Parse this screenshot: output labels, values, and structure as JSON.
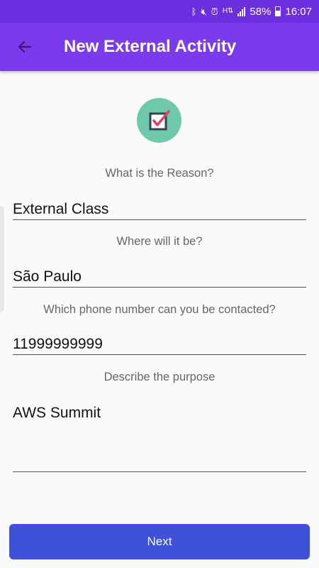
{
  "status_bar": {
    "battery": "58%",
    "time": "16:07",
    "icons": [
      "bluetooth-icon",
      "mute-icon",
      "alarm-icon",
      "data-icon",
      "signal-icon",
      "battery-icon"
    ]
  },
  "app_bar": {
    "title": "New External Activity",
    "color": "#7c3aed"
  },
  "form": {
    "reason": {
      "label": "What is the Reason?",
      "value": "External Class"
    },
    "location": {
      "label": "Where will it be?",
      "value": "São Paulo"
    },
    "phone": {
      "label": "Which phone number can you be contacted?",
      "value": "11999999999"
    },
    "purpose": {
      "label": "Describe the purpose",
      "value": "AWS Summit"
    }
  },
  "actions": {
    "next_label": "Next",
    "next_color": "#3f51d8"
  }
}
